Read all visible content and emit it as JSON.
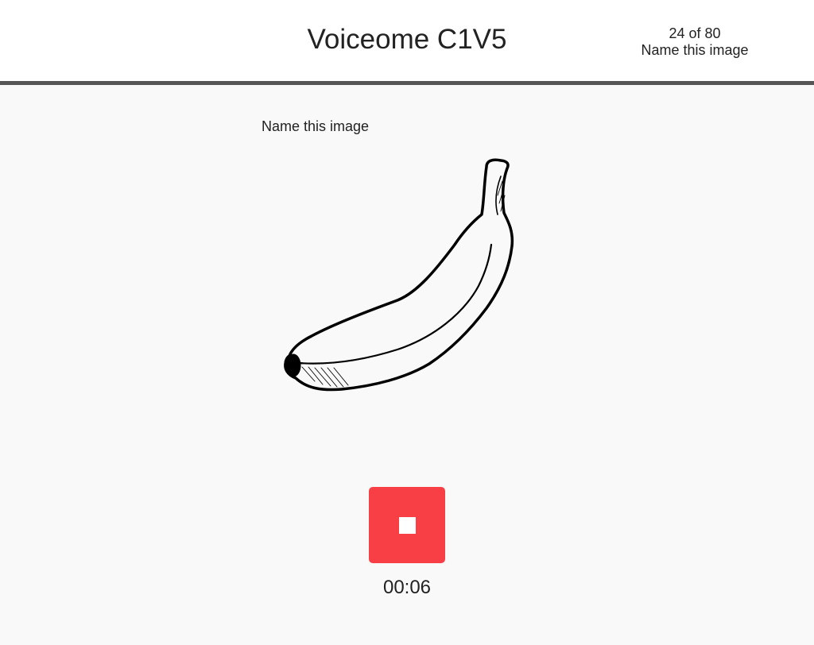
{
  "header": {
    "title": "Voiceome C1V5",
    "progress_text": "24 of 80",
    "task_name": "Name this image"
  },
  "task": {
    "prompt": "Name this image",
    "stimulus": "banana-line-drawing"
  },
  "recorder": {
    "state": "recording",
    "button_icon": "stop-icon",
    "button_color": "#f73f45",
    "elapsed": "00:06"
  }
}
